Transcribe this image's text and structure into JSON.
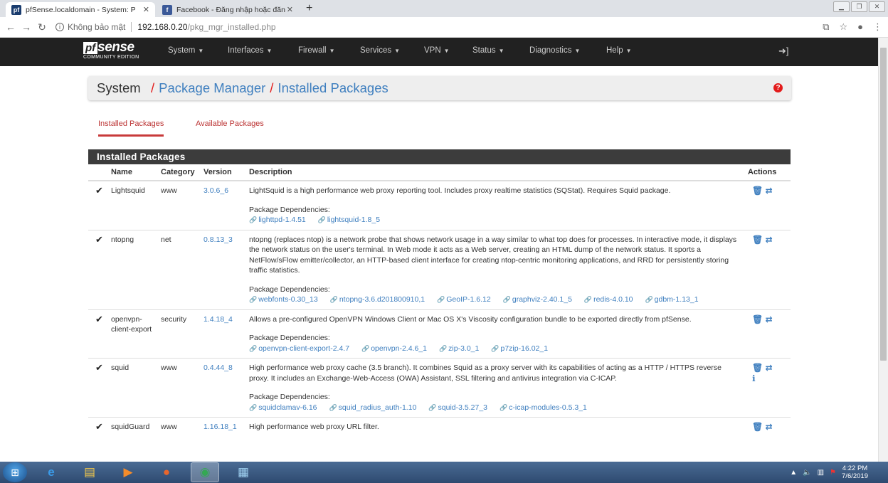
{
  "browser": {
    "tabs": [
      {
        "title": "pfSense.localdomain - System: P",
        "icon": "pfsense-icon"
      },
      {
        "title": "Facebook - Đăng nhập hoặc đăn",
        "icon": "facebook-icon"
      }
    ],
    "new_tab": "+",
    "address": {
      "security": "Không bảo mật",
      "host": "192.168.0.20",
      "path": "/pkg_mgr_installed.php"
    }
  },
  "navbar": {
    "logo_brand": "sense",
    "logo_edition": "COMMUNITY EDITION",
    "menu": [
      "System",
      "Interfaces",
      "Firewall",
      "Services",
      "VPN",
      "Status",
      "Diagnostics",
      "Help"
    ]
  },
  "breadcrumb": {
    "root": "System",
    "level1": "Package Manager",
    "level2": "Installed Packages"
  },
  "page_tabs": [
    "Installed Packages",
    "Available Packages"
  ],
  "panel": {
    "title": "Installed Packages",
    "columns": [
      "Name",
      "Category",
      "Version",
      "Description",
      "Actions"
    ],
    "dep_label": "Package Dependencies:",
    "rows": [
      {
        "name": "Lightsquid",
        "category": "www",
        "version": "3.0.6_6",
        "description": "LightSquid is a high performance web proxy reporting tool. Includes proxy realtime statistics (SQStat). Requires Squid package.",
        "deps": [
          "lighttpd-1.4.51",
          "lightsquid-1.8_5"
        ]
      },
      {
        "name": "ntopng",
        "category": "net",
        "version": "0.8.13_3",
        "description": "ntopng (replaces ntop) is a network probe that shows network usage in a way similar to what top does for processes. In interactive mode, it displays the network status on the user's terminal. In Web mode it acts as a Web server, creating an HTML dump of the network status. It sports a NetFlow/sFlow emitter/collector, an HTTP-based client interface for creating ntop-centric monitoring applications, and RRD for persistently storing traffic statistics.",
        "deps": [
          "webfonts-0.30_13",
          "ntopng-3.6.d201800910,1",
          "GeoIP-1.6.12",
          "graphviz-2.40.1_5",
          "redis-4.0.10",
          "gdbm-1.13_1"
        ]
      },
      {
        "name": "openvpn-client-export",
        "category": "security",
        "version": "1.4.18_4",
        "description": "Allows a pre-configured OpenVPN Windows Client or Mac OS X's Viscosity configuration bundle to be exported directly from pfSense.",
        "deps": [
          "openvpn-client-export-2.4.7",
          "openvpn-2.4.6_1",
          "zip-3.0_1",
          "p7zip-16.02_1"
        ]
      },
      {
        "name": "squid",
        "category": "www",
        "version": "0.4.44_8",
        "description": "High performance web proxy cache (3.5 branch). It combines Squid as a proxy server with its capabilities of acting as a HTTP / HTTPS reverse proxy. It includes an Exchange-Web-Access (OWA) Assistant, SSL filtering and antivirus integration via C-ICAP.",
        "deps": [
          "squidclamav-6.16",
          "squid_radius_auth-1.10",
          "squid-3.5.27_3",
          "c-icap-modules-0.5.3_1"
        ]
      },
      {
        "name": "squidGuard",
        "category": "www",
        "version": "1.16.18_1",
        "description": "High performance web proxy URL filter.",
        "deps": []
      }
    ]
  },
  "taskbar": {
    "time": "4:22 PM",
    "date": "7/6/2019"
  }
}
